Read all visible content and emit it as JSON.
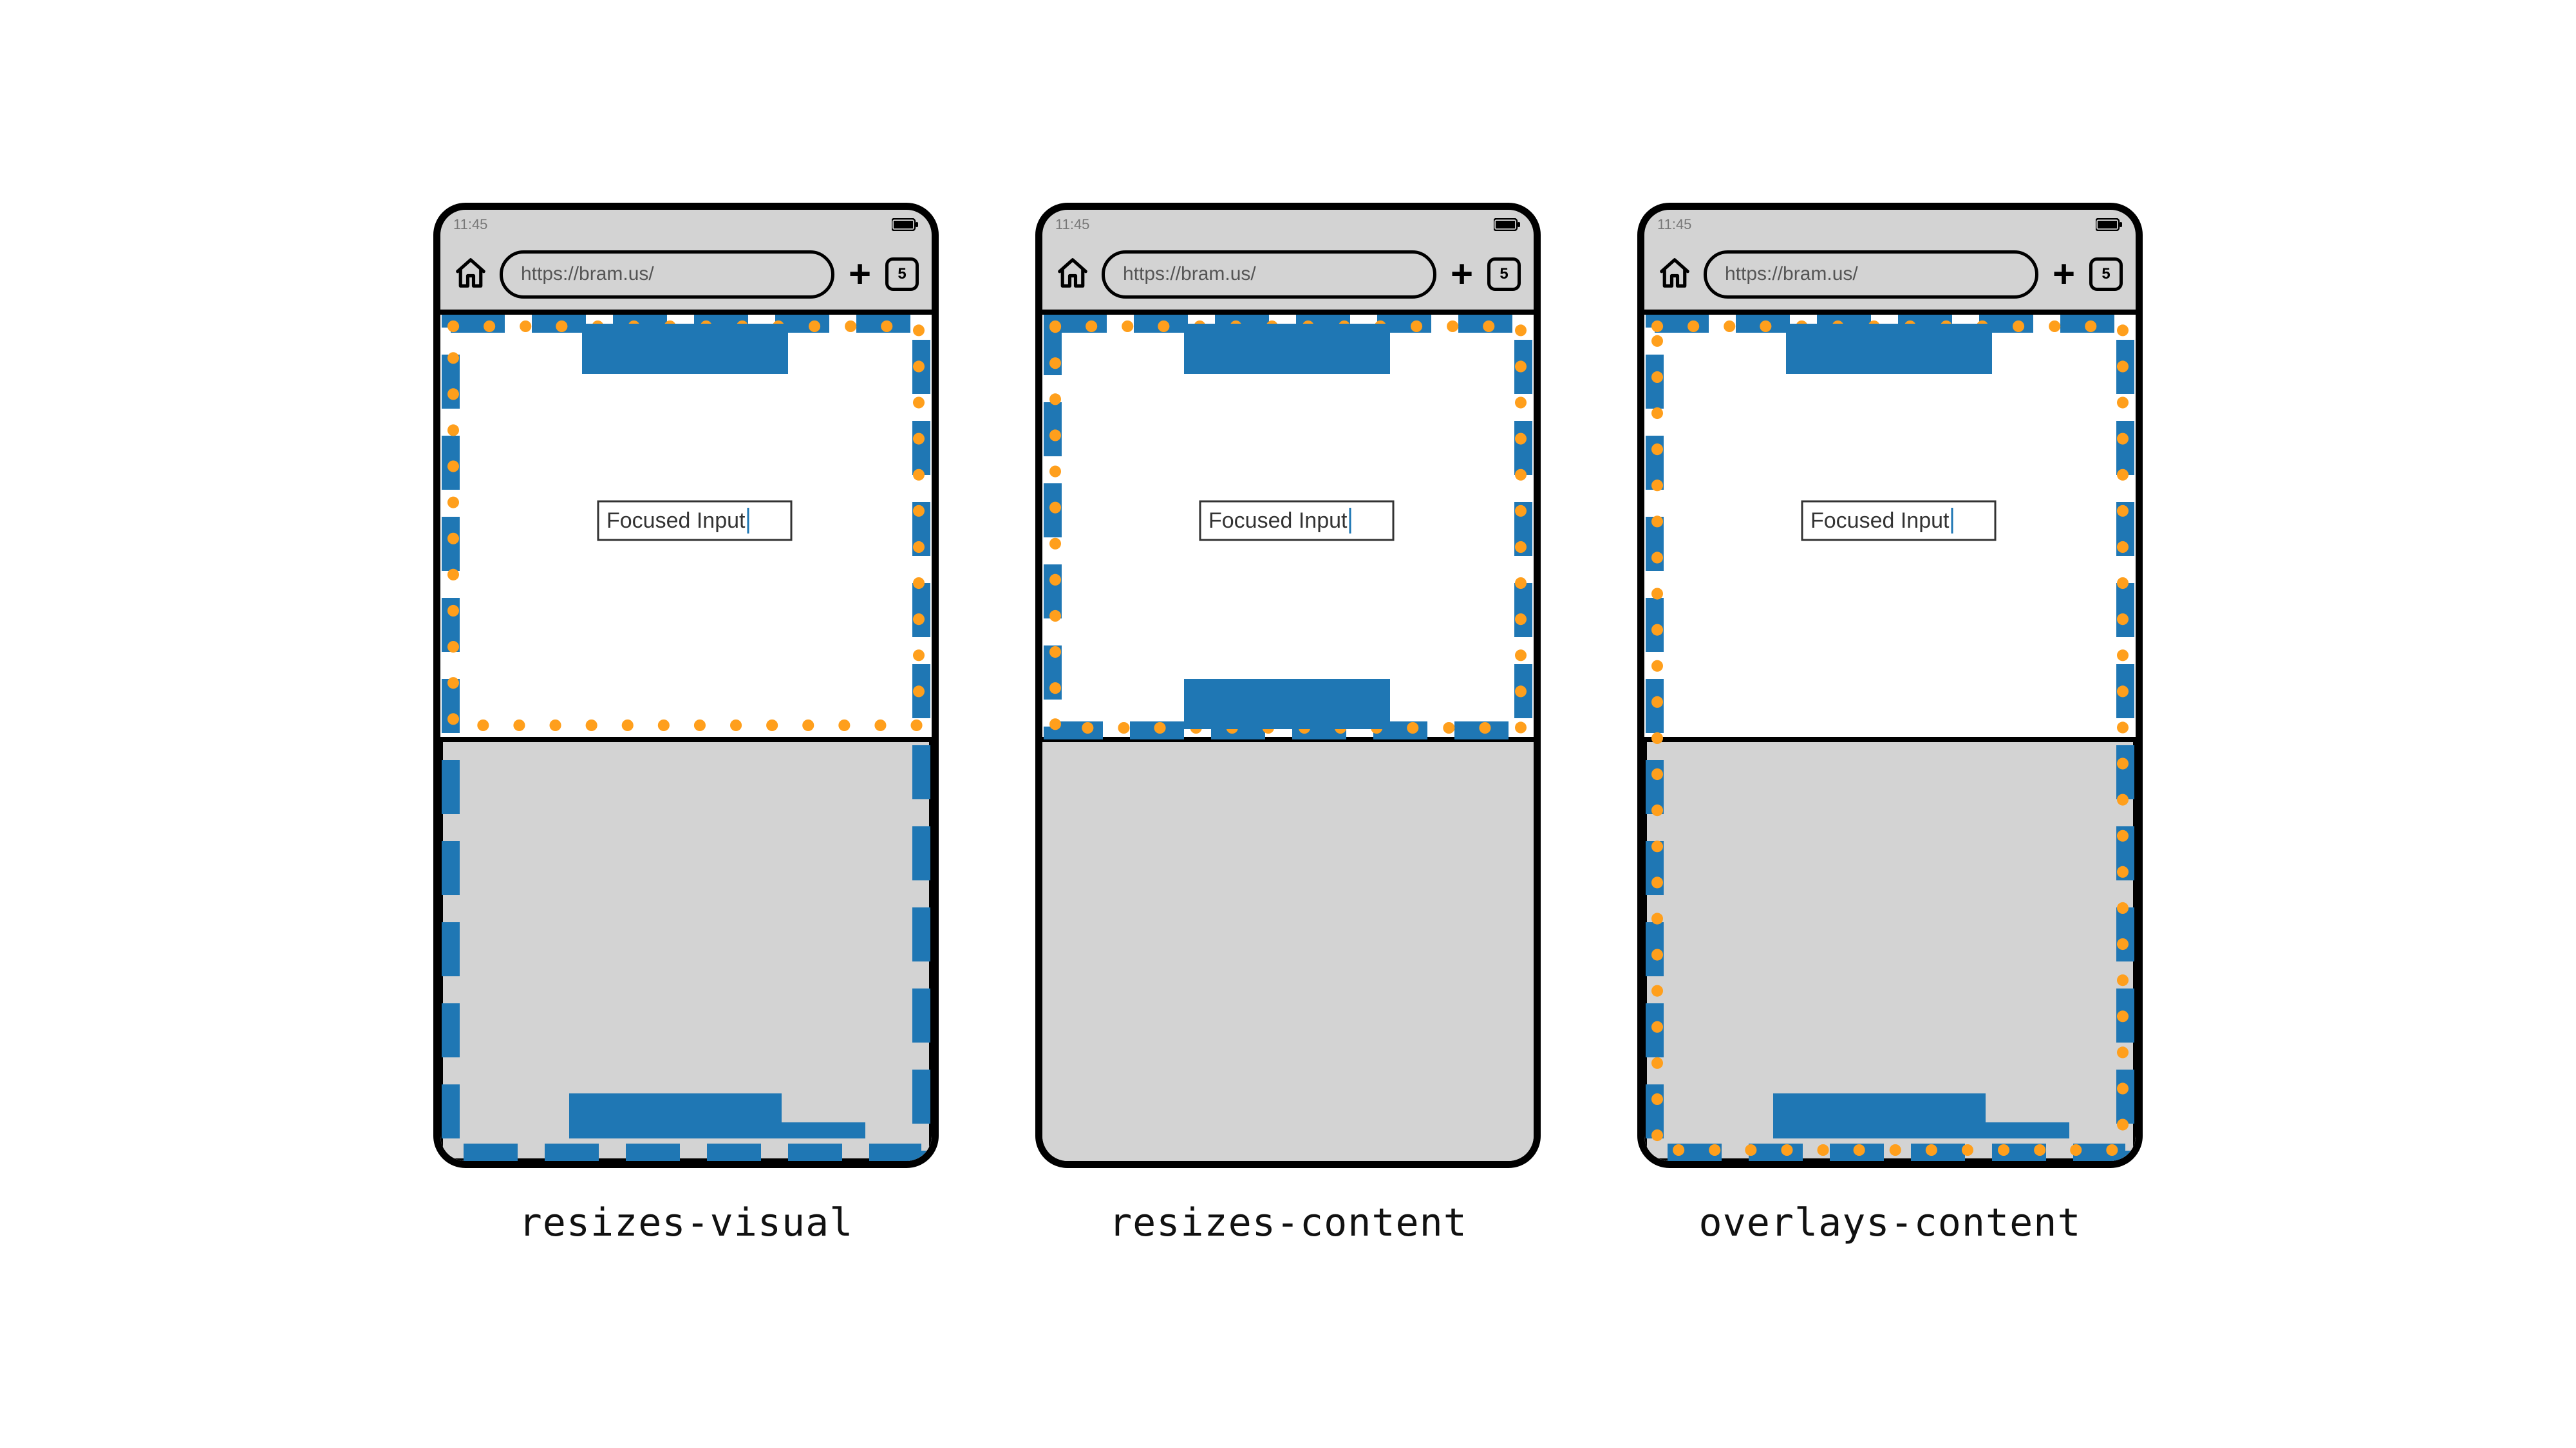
{
  "browser": {
    "time": "11:45",
    "url": "https://bram.us/",
    "tab_count": "5"
  },
  "input": {
    "label": "Focused Input"
  },
  "captions": {
    "a": "resizes-visual",
    "b": "resizes-content",
    "c": "overlays-content"
  },
  "colors": {
    "blue": "#1f77b4",
    "orange": "#ff9f1c",
    "gray": "#d3d3d3"
  }
}
